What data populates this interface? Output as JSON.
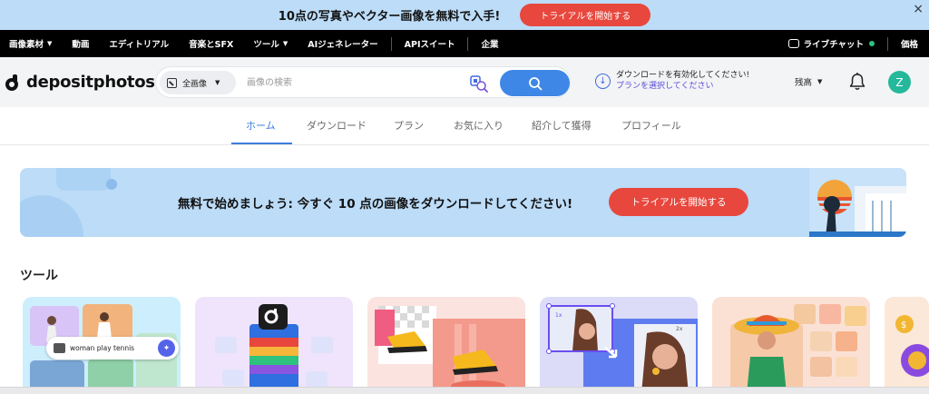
{
  "promo": {
    "text": "10点の写真やベクター画像を無料で入手!",
    "button": "トライアルを開始する",
    "close": "×"
  },
  "topnav": {
    "items": [
      "画像素材",
      "動画",
      "エディトリアル",
      "音楽とSFX",
      "ツール",
      "AIジェネレーター",
      "APIスイート",
      "企業"
    ],
    "live_chat": "ライブチャット",
    "pricing": "価格",
    "status_color": "#2ec27e"
  },
  "header": {
    "logo": "depositphotos",
    "search_type": "全画像",
    "search_placeholder": "画像の検索",
    "download_notice": "ダウンロードを有効化してください!",
    "download_link": "プランを選択してください",
    "credits_label": "残高",
    "avatar_initial": "Z",
    "accent_color": "#3f87e6"
  },
  "tabs": [
    {
      "label": "ホーム",
      "active": true
    },
    {
      "label": "ダウンロード",
      "active": false
    },
    {
      "label": "プラン",
      "active": false
    },
    {
      "label": "お気に入り",
      "active": false
    },
    {
      "label": "紹介して獲得",
      "active": false
    },
    {
      "label": "プロフィール",
      "active": false
    }
  ],
  "hero": {
    "text": "無料で始めましょう: 今すぐ 10 点の画像をダウンロードしてください!",
    "button": "トライアルを開始する",
    "button_color": "#e8473d"
  },
  "tools": {
    "title": "ツール",
    "search_prompt": "woman play tennis",
    "size_labels": [
      "1x",
      "2x"
    ]
  },
  "icons": [
    "chevron-down-icon",
    "chat-icon",
    "visual-search-icon",
    "search-icon",
    "download-icon",
    "bell-icon",
    "sparkle-icon",
    "close-icon"
  ]
}
